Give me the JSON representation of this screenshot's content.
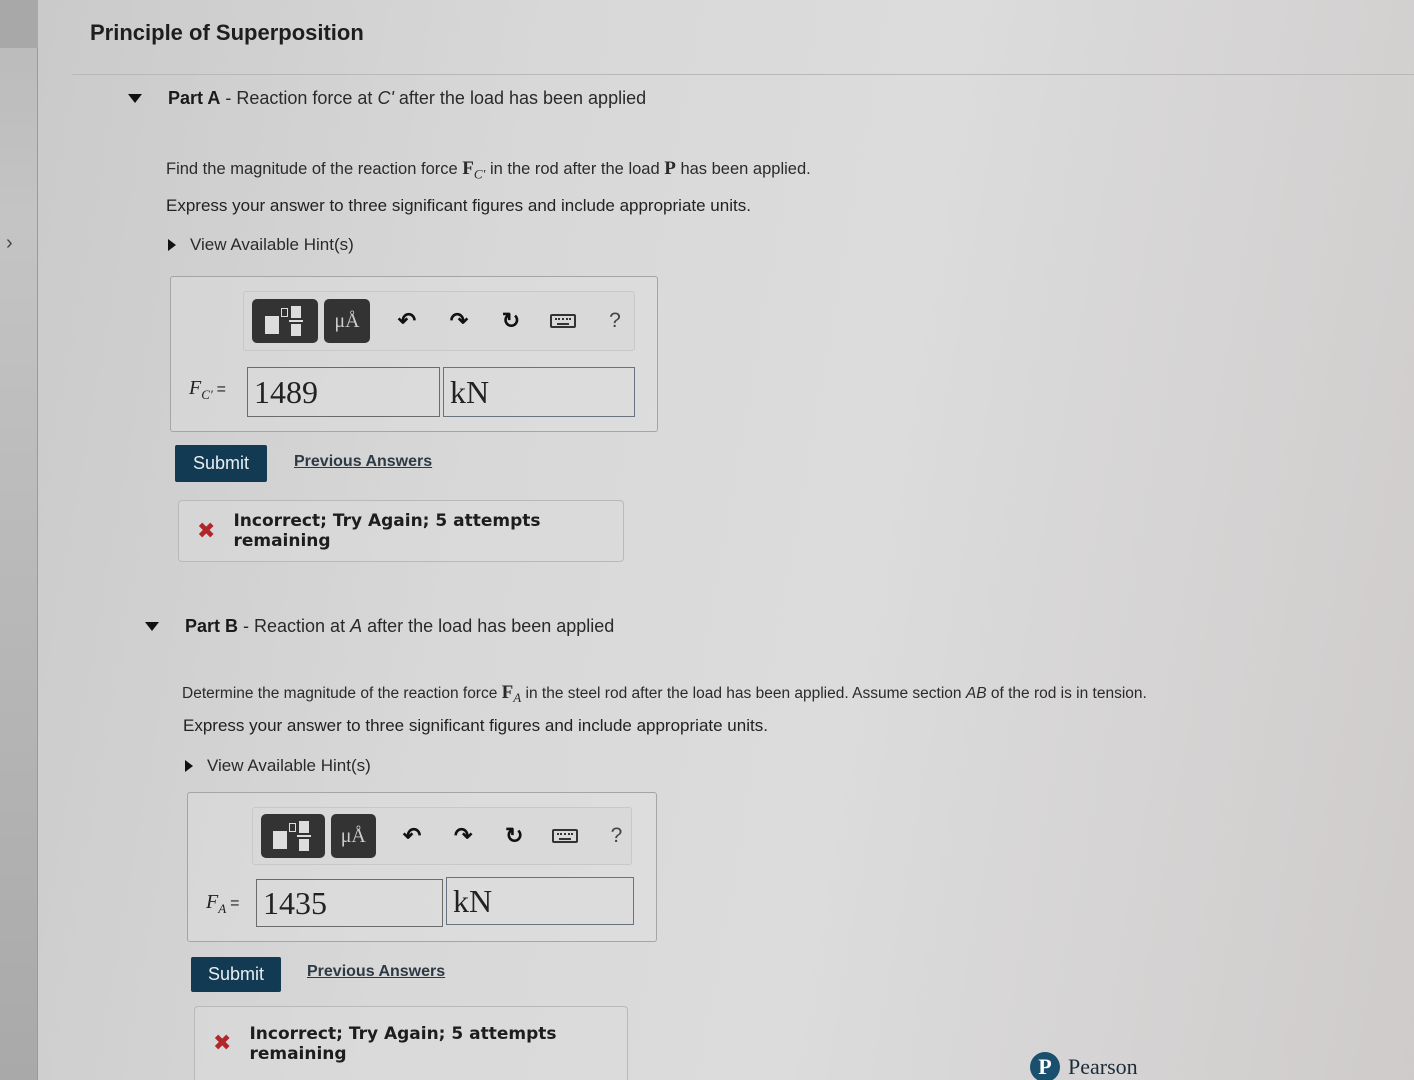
{
  "page": {
    "title": "Principle of Superposition",
    "sidebar_toggle_icon": "chevron-right-icon"
  },
  "parts": [
    {
      "label": "Part A",
      "separator": "-",
      "heading_pre": "Reaction force at",
      "heading_var": "C'",
      "heading_post": "after the load has been applied",
      "question_pre": "Find the magnitude of the reaction force",
      "question_var": "F",
      "question_var_sub": "C'",
      "question_mid": "in the rod after the load",
      "question_var2": "P",
      "question_post": "has been applied.",
      "instruction": "Express your answer to three significant figures and include appropriate units.",
      "hint_label": "View Available Hint(s)",
      "toolbar": {
        "template_icon": "fraction-template-icon",
        "units_icon": "units-icon",
        "units_label": "μÅ",
        "undo_icon": "undo-icon",
        "redo_icon": "redo-icon",
        "reset_icon": "reset-icon",
        "keyboard_icon": "keyboard-icon",
        "help_label": "?"
      },
      "answer_var": "F",
      "answer_var_sub": "C'",
      "answer_eq": "=",
      "answer_value": "1489",
      "answer_unit": "kN",
      "submit_label": "Submit",
      "previous_answers_label": "Previous Answers",
      "feedback": {
        "icon": "x-icon",
        "text": "Incorrect; Try Again; 5 attempts remaining",
        "status_color": "#b0262a"
      }
    },
    {
      "label": "Part B",
      "separator": "-",
      "heading_pre": "Reaction at",
      "heading_var": "A",
      "heading_post": "after the load has been applied",
      "question_pre": "Determine the magnitude of the reaction force",
      "question_var": "F",
      "question_var_sub": "A",
      "question_mid": "in the steel rod after the load has been applied. Assume section",
      "question_var2": "AB",
      "question_post": "of the rod is in tension.",
      "instruction": "Express your answer to three significant figures and include appropriate units.",
      "hint_label": "View Available Hint(s)",
      "toolbar": {
        "template_icon": "fraction-template-icon",
        "units_icon": "units-icon",
        "units_label": "μÅ",
        "undo_icon": "undo-icon",
        "redo_icon": "redo-icon",
        "reset_icon": "reset-icon",
        "keyboard_icon": "keyboard-icon",
        "help_label": "?"
      },
      "answer_var": "F",
      "answer_var_sub": "A",
      "answer_eq": "=",
      "answer_value": "1435",
      "answer_unit": "kN",
      "submit_label": "Submit",
      "previous_answers_label": "Previous Answers",
      "feedback": {
        "icon": "x-icon",
        "text": "Incorrect; Try Again; 5 attempts remaining",
        "status_color": "#b0262a"
      }
    }
  ],
  "footer": {
    "brand": "Pearson",
    "brand_icon": "pearson-logo-icon",
    "brand_color": "#1a4f6e"
  }
}
